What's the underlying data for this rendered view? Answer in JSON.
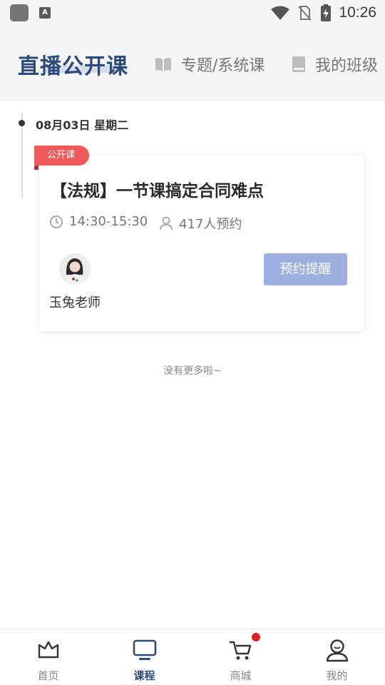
{
  "status_bar": {
    "time": "10:26",
    "a_icon_label": "A",
    "icons": [
      "app-icon",
      "a-icon",
      "wifi-icon",
      "no-sim-icon",
      "battery-charging-icon"
    ]
  },
  "top_nav": {
    "active_tab": "直播公开课",
    "tabs": [
      {
        "label": "专题/系统课",
        "icon": "book-open-icon"
      },
      {
        "label": "我的班级",
        "icon": "book-icon"
      }
    ]
  },
  "timeline": {
    "date": "08月03日 星期二"
  },
  "course_card": {
    "badge": "公开课",
    "title": "【法规】一节课搞定合同难点",
    "time": "14:30-15:30",
    "reservations": "417人预约",
    "teacher": "玉兔老师",
    "button": "预约提醒"
  },
  "list_end_text": "没有更多啦~",
  "bottom_nav": {
    "items": [
      {
        "label": "首页",
        "icon": "home-crown-icon",
        "active": false
      },
      {
        "label": "课程",
        "icon": "tv-icon",
        "active": true
      },
      {
        "label": "商城",
        "icon": "cart-icon",
        "active": false,
        "has_badge": true
      },
      {
        "label": "我的",
        "icon": "user-icon",
        "active": false
      }
    ]
  },
  "colors": {
    "accent": "#2e4a78",
    "badge_red": "#f05a5a",
    "button_bg": "#9daee0",
    "notification_dot": "#e02020"
  }
}
